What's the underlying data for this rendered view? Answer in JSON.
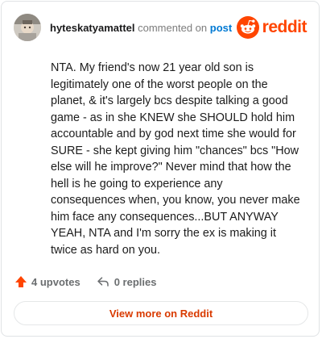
{
  "comment": {
    "username": "hyteskatyamattel",
    "action_text": "commented on",
    "post_link": "post",
    "body": "NTA. My friend's now 21 year old son is legitimately one of the worst people on the planet, & it's largely bcs despite talking a good game - as in she KNEW she SHOULD hold him accountable and by god next time she would for SURE - she kept giving him \"chances\" bcs \"How else will he improve?\" Never mind that how the hell is he going to experience any consequences when, you know, you never make him face any consequences...BUT ANYWAY YEAH, NTA and I'm sorry the ex is making it twice as hard on you."
  },
  "brand": {
    "wordmark": "reddit",
    "color": "#ff4500"
  },
  "actions": {
    "upvotes_label": "4 upvotes",
    "replies_label": "0 replies"
  },
  "footer": {
    "view_more_label": "View more on Reddit"
  },
  "icons": {
    "upvote": "upvote-arrow-icon",
    "reply": "reply-arrow-icon",
    "logo": "reddit-snoo-icon"
  },
  "colors": {
    "accent": "#ff4500",
    "link": "#0079d3",
    "muted": "#7c7c7c",
    "button_text": "#d93a00"
  }
}
